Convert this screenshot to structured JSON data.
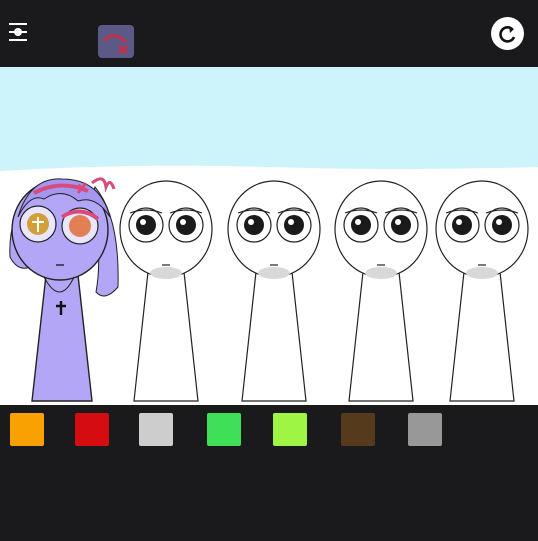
{
  "toolbar": {
    "menu_icon": "menu-sliders-icon",
    "effect_icon": "curve-cross-effect-icon",
    "reset_icon": "reset-arrow-icon"
  },
  "stage": {
    "sky_color": "#cdf3fb",
    "ground_color": "#ffffff",
    "characters": [
      {
        "id": "purple-character",
        "body_color": "#b3a6f7",
        "hair_color": "#b3a6f7",
        "accessory": "cross-necklace"
      },
      {
        "id": "blank-character-1",
        "body_color": "#ffffff"
      },
      {
        "id": "blank-character-2",
        "body_color": "#ffffff"
      },
      {
        "id": "blank-character-3",
        "body_color": "#ffffff"
      },
      {
        "id": "blank-character-4",
        "body_color": "#ffffff"
      }
    ]
  },
  "palette": {
    "swatches": [
      {
        "name": "orange",
        "color": "#f9a100"
      },
      {
        "name": "red",
        "color": "#d50d10"
      },
      {
        "name": "light-gray",
        "color": "#cdcdcd"
      },
      {
        "name": "green",
        "color": "#3fdf57"
      },
      {
        "name": "lime",
        "color": "#9ff543"
      },
      {
        "name": "brown",
        "color": "#553a1c"
      },
      {
        "name": "gray",
        "color": "#989898"
      }
    ]
  }
}
